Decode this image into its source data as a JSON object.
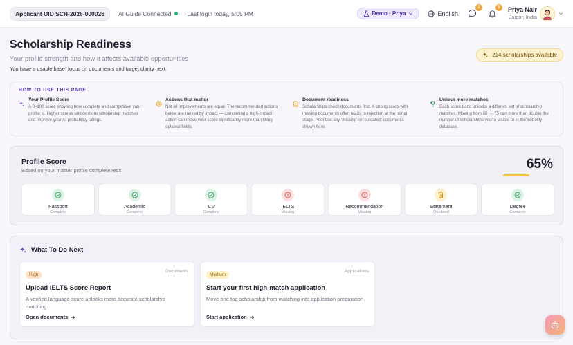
{
  "topbar": {
    "uid": "Applicant UID SCH-2026-000026",
    "ai_guide": "AI Guide Connected",
    "last_login": "Last login today, 5:05 PM",
    "demo_label": "Demo · Priya",
    "language": "English",
    "messages_badge": "2",
    "notifications_badge": "5",
    "user_name": "Priya Nair",
    "user_location": "Jaipur, India"
  },
  "header": {
    "title": "Scholarship Readiness",
    "subtitle": "Your profile strength and how it affects available opportunities",
    "note": "You have a usable base; focus on documents and target clarity next.",
    "scholarships_available": "214 scholarships available"
  },
  "howto": {
    "title": "HOW TO USE THIS PAGE",
    "items": [
      {
        "title": "Your Profile Score",
        "text": "A 0–100 score showing how complete and competitive your profile is. Higher scores unlock more scholarship matches and improve your AI probability ratings."
      },
      {
        "title": "Actions that matter",
        "text": "Not all improvements are equal. The recommended actions below are ranked by impact — completing a high-impact action can move your score significantly more than filling optional fields."
      },
      {
        "title": "Document readiness",
        "text": "Scholarships check documents first. A strong score with missing documents often leads to rejection at the portal stage. Prioritise any 'missing' or 'outdated' documents shown here."
      },
      {
        "title": "Unlock more matches",
        "text": "Each score band unlocks a different set of scholarship matches. Moving from 60 → 75 can more than double the number of scholarships you're visible to in the Scholify database."
      }
    ]
  },
  "score": {
    "title": "Profile Score",
    "subtitle": "Based on your master profile completeness",
    "percent_text": "65%",
    "value": 65,
    "bar_color": "#f0c54a",
    "docs": [
      {
        "name": "Passport",
        "status": "Complete",
        "state": "ok"
      },
      {
        "name": "Academic",
        "status": "Complete",
        "state": "ok"
      },
      {
        "name": "CV",
        "status": "Complete",
        "state": "ok"
      },
      {
        "name": "IELTS",
        "status": "Missing",
        "state": "bad"
      },
      {
        "name": "Recommendation",
        "status": "Missing",
        "state": "bad"
      },
      {
        "name": "Statement",
        "status": "Outdated",
        "state": "old"
      },
      {
        "name": "Degree",
        "status": "Complete",
        "state": "ok"
      }
    ]
  },
  "next": {
    "title": "What To Do Next",
    "tasks": [
      {
        "priority": "High",
        "category": "Documents",
        "title": "Upload IELTS Score Report",
        "desc": "A verified language score unlocks more accurate scholarship matching.",
        "link": "Open documents"
      },
      {
        "priority": "Medium",
        "category": "Applications",
        "title": "Start your first high-match application",
        "desc": "Move one top scholarship from matching into application preparation.",
        "link": "Start application"
      }
    ]
  }
}
